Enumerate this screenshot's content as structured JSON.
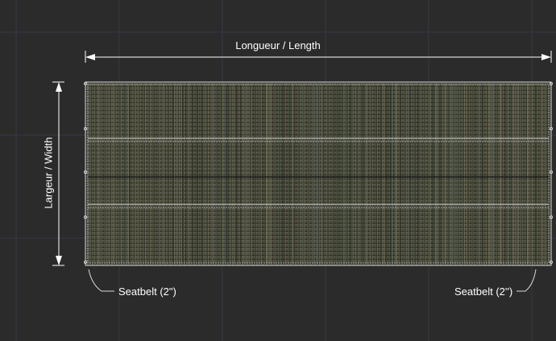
{
  "dimensions": {
    "length_label": "Longueur / Length",
    "width_label": "Largeur / Width"
  },
  "callouts": {
    "seatbelt_left": "Seatbelt (2\")",
    "seatbelt_right": "Seatbelt (2'')"
  },
  "colors": {
    "background": "#2b2b2b",
    "grid": "#353a45",
    "mesh_base": "#3e3f33",
    "dimension_line": "#ffffff",
    "seatbelt_line": "#d8d8d8"
  }
}
